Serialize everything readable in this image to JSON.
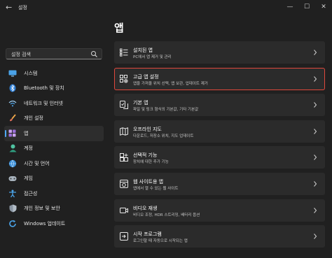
{
  "window": {
    "title": "설정"
  },
  "search": {
    "value": "설정 검색"
  },
  "sidebar": {
    "items": [
      {
        "label": "시스템",
        "icon": "monitor-icon"
      },
      {
        "label": "Bluetooth 및 장치",
        "icon": "bluetooth-icon"
      },
      {
        "label": "네트워크 및 인터넷",
        "icon": "wifi-icon"
      },
      {
        "label": "개인 설정",
        "icon": "brush-icon"
      },
      {
        "label": "앱",
        "icon": "apps-icon",
        "active": true
      },
      {
        "label": "계정",
        "icon": "account-icon"
      },
      {
        "label": "시간 및 언어",
        "icon": "globe-clock-icon"
      },
      {
        "label": "게임",
        "icon": "gamepad-icon"
      },
      {
        "label": "접근성",
        "icon": "accessibility-icon"
      },
      {
        "label": "개인 정보 및 보안",
        "icon": "shield-icon"
      },
      {
        "label": "Windows 업데이트",
        "icon": "update-icon"
      }
    ]
  },
  "main": {
    "title": "앱",
    "cards": [
      {
        "title": "설치된 앱",
        "subtitle": "PC에서 앱 제거 및 관리",
        "icon": "installed-apps-icon"
      },
      {
        "title": "고급 앱 설정",
        "subtitle": "앱을 가져올 위치 선택, 앱 보관, 업데이트 제거",
        "icon": "advanced-apps-icon",
        "highlighted": true
      },
      {
        "title": "기본 앱",
        "subtitle": "파일 및 링크 형식의 기본값, 기타 기본값",
        "icon": "default-apps-icon"
      },
      {
        "title": "오프라인 지도",
        "subtitle": "다운로드, 저장소 위치, 지도 업데이트",
        "icon": "map-icon"
      },
      {
        "title": "선택적 기능",
        "subtitle": "장치에 대한 추가 기능",
        "icon": "optional-features-icon"
      },
      {
        "title": "웹 사이트용 앱",
        "subtitle": "앱에서 열 수 있는 웹 사이트",
        "icon": "web-apps-icon"
      },
      {
        "title": "비디오 재생",
        "subtitle": "비디오 조정, HDR 스트리밍, 배터리 옵션",
        "icon": "video-icon"
      },
      {
        "title": "시작 프로그램",
        "subtitle": "로그인할 때 자동으로 시작되는 앱",
        "icon": "startup-icon"
      }
    ]
  },
  "colors": {
    "background": "#202020",
    "card": "#2b2b2b",
    "accent": "#4ea8ff",
    "highlight_border": "#e0483c"
  }
}
